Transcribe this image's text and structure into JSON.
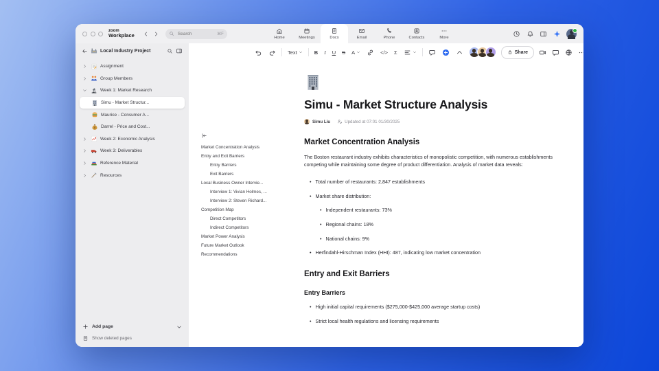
{
  "titlebar": {
    "traffic_lights": [
      {
        "name": "close-button"
      },
      {
        "name": "minimize-button"
      },
      {
        "name": "maximize-button"
      }
    ],
    "brand_top": "zoom",
    "brand_bottom": "Workplace",
    "search_placeholder": "Search",
    "search_shortcut": "⌘F",
    "tabs": [
      {
        "label": "Home",
        "icon": "home",
        "active": false
      },
      {
        "label": "Meetings",
        "icon": "calendar",
        "active": false
      },
      {
        "label": "Docs",
        "icon": "doc",
        "active": true
      },
      {
        "label": "Email",
        "icon": "mail",
        "active": false
      },
      {
        "label": "Phone",
        "icon": "phone",
        "active": false
      },
      {
        "label": "Contacts",
        "icon": "contacts",
        "active": false
      },
      {
        "label": "More",
        "icon": "more-dots",
        "active": false
      }
    ],
    "right_icons": [
      {
        "name": "history-clock-icon",
        "icon": "clock"
      },
      {
        "name": "notifications-bell-icon",
        "icon": "bell"
      },
      {
        "name": "side-panel-icon",
        "icon": "panel"
      },
      {
        "name": "ai-companion-icon",
        "icon": "sparkle"
      }
    ],
    "user_status_color": "#2fb344"
  },
  "sidebar": {
    "project_icon": "factory",
    "project_title": "Local Industry Project",
    "items": [
      {
        "label": "Assignment",
        "icon": "memo",
        "chevron": "right",
        "child": false,
        "selected": false
      },
      {
        "label": "Group Members",
        "icon": "people",
        "chevron": "right",
        "child": false,
        "selected": false
      },
      {
        "label": "Week 1: Market Research",
        "icon": "microscope",
        "chevron": "down",
        "child": false,
        "selected": false
      },
      {
        "label": "Simu - Market Structur...",
        "icon": "building",
        "chevron": null,
        "child": true,
        "selected": true
      },
      {
        "label": "Maurice - Consumer A...",
        "icon": "burger",
        "chevron": null,
        "child": true,
        "selected": false
      },
      {
        "label": "Darrel - Price and Cost...",
        "icon": "moneybag",
        "chevron": null,
        "child": true,
        "selected": false
      },
      {
        "label": "Week 2: Economic Analysis",
        "icon": "chart-up",
        "chevron": "right",
        "child": false,
        "selected": false
      },
      {
        "label": "Week 3: Deliverables",
        "icon": "truck",
        "chevron": "right",
        "child": false,
        "selected": false
      },
      {
        "label": "Reference Material",
        "icon": "books",
        "chevron": "right",
        "child": false,
        "selected": false
      },
      {
        "label": "Resources",
        "icon": "pick",
        "chevron": "right",
        "child": false,
        "selected": false
      }
    ],
    "add_page_label": "Add page",
    "show_deleted_label": "Show deleted pages"
  },
  "toolbar": {
    "buttons": [
      {
        "type": "icon",
        "name": "undo-button",
        "icon": "undo"
      },
      {
        "type": "icon",
        "name": "redo-button",
        "icon": "redo"
      },
      {
        "type": "divider"
      },
      {
        "type": "label",
        "name": "text-style-dropdown",
        "label": "Text",
        "chevron": true
      },
      {
        "type": "divider"
      },
      {
        "type": "label",
        "name": "bold-button",
        "label": "B",
        "style": "b"
      },
      {
        "type": "label",
        "name": "italic-button",
        "label": "I",
        "style": "i"
      },
      {
        "type": "label",
        "name": "underline-button",
        "label": "U",
        "style": "u"
      },
      {
        "type": "label",
        "name": "strikethrough-button",
        "label": "S",
        "style": "s"
      },
      {
        "type": "label",
        "name": "text-color-dropdown",
        "label": "A",
        "chevron": true
      },
      {
        "type": "icon",
        "name": "link-button",
        "icon": "link"
      },
      {
        "type": "label",
        "name": "code-button",
        "label": "</>"
      },
      {
        "type": "label",
        "name": "equation-button",
        "label": "Σ"
      },
      {
        "type": "icon",
        "name": "align-dropdown",
        "icon": "align",
        "chevron": true
      },
      {
        "type": "divider"
      },
      {
        "type": "icon",
        "name": "comment-button",
        "icon": "comment"
      },
      {
        "type": "icon",
        "name": "ai-add-button",
        "icon": "plus-circle"
      },
      {
        "type": "icon",
        "name": "collapse-toolbar-button",
        "icon": "chev-u"
      }
    ],
    "collaborator_avatars": [
      {
        "name": "collaborator-avatar-1",
        "color": "#a9b9ee"
      },
      {
        "name": "collaborator-avatar-2",
        "color": "#e9c9a0"
      },
      {
        "name": "collaborator-avatar-3",
        "color": "#b2a0ea"
      }
    ],
    "share_label": "Share",
    "right_buttons": [
      {
        "name": "video-call-button",
        "icon": "camera"
      },
      {
        "name": "chat-button",
        "icon": "chat"
      },
      {
        "name": "language-button",
        "icon": "globe"
      },
      {
        "name": "more-options-button",
        "icon": "more-dots"
      }
    ]
  },
  "outline": {
    "items": [
      {
        "label": "Market Concentration Analysis",
        "level": 0
      },
      {
        "label": "Entry and Exit Barriers",
        "level": 0
      },
      {
        "label": "Entry Barriers",
        "level": 1
      },
      {
        "label": "Exit Barriers",
        "level": 1
      },
      {
        "label": "Local Business Owner Intervie...",
        "level": 0
      },
      {
        "label": "Interview 1: Vivian Holmes, ...",
        "level": 1
      },
      {
        "label": "Interview 2: Steven Richard...",
        "level": 1
      },
      {
        "label": "Competition Map",
        "level": 0
      },
      {
        "label": "Direct Competitors",
        "level": 1
      },
      {
        "label": "Indirect Competitors",
        "level": 1
      },
      {
        "label": "Market Power Analysis",
        "level": 0
      },
      {
        "label": "Future Market Outlook",
        "level": 0
      },
      {
        "label": "Recommendations",
        "level": 0
      }
    ]
  },
  "document": {
    "icon": "office-building",
    "title": "Simu - Market Structure Analysis",
    "author": "Simu Liu",
    "updated": "Updated at 07:01 01/30/2025",
    "blocks": [
      {
        "type": "h2",
        "text": "Market Concentration Analysis"
      },
      {
        "type": "p",
        "text": "The Boston restaurant industry exhibits characteristics of monopolistic competition, with numerous establishments competing while maintaining some degree of product differentiation. Analysis of market data reveals:"
      },
      {
        "type": "li",
        "level": 1,
        "text": "Total number of restaurants: 2,847 establishments"
      },
      {
        "type": "li",
        "level": 1,
        "text": "Market share distribution:"
      },
      {
        "type": "li",
        "level": 2,
        "text": "Independent restaurants: 73%"
      },
      {
        "type": "li",
        "level": 2,
        "text": "Regional chains: 18%"
      },
      {
        "type": "li",
        "level": 2,
        "text": "National chains: 9%"
      },
      {
        "type": "li",
        "level": 1,
        "text": "Herfindahl-Hirschman Index (HHI): 487, indicating low market concentration"
      },
      {
        "type": "h2",
        "text": "Entry and Exit Barriers"
      },
      {
        "type": "h3",
        "text": "Entry Barriers"
      },
      {
        "type": "li",
        "level": 1,
        "text": "High initial capital requirements ($275,000-$425,000 average startup costs)"
      },
      {
        "type": "li",
        "level": 1,
        "text": "Strict local health regulations and licensing requirements"
      }
    ]
  }
}
